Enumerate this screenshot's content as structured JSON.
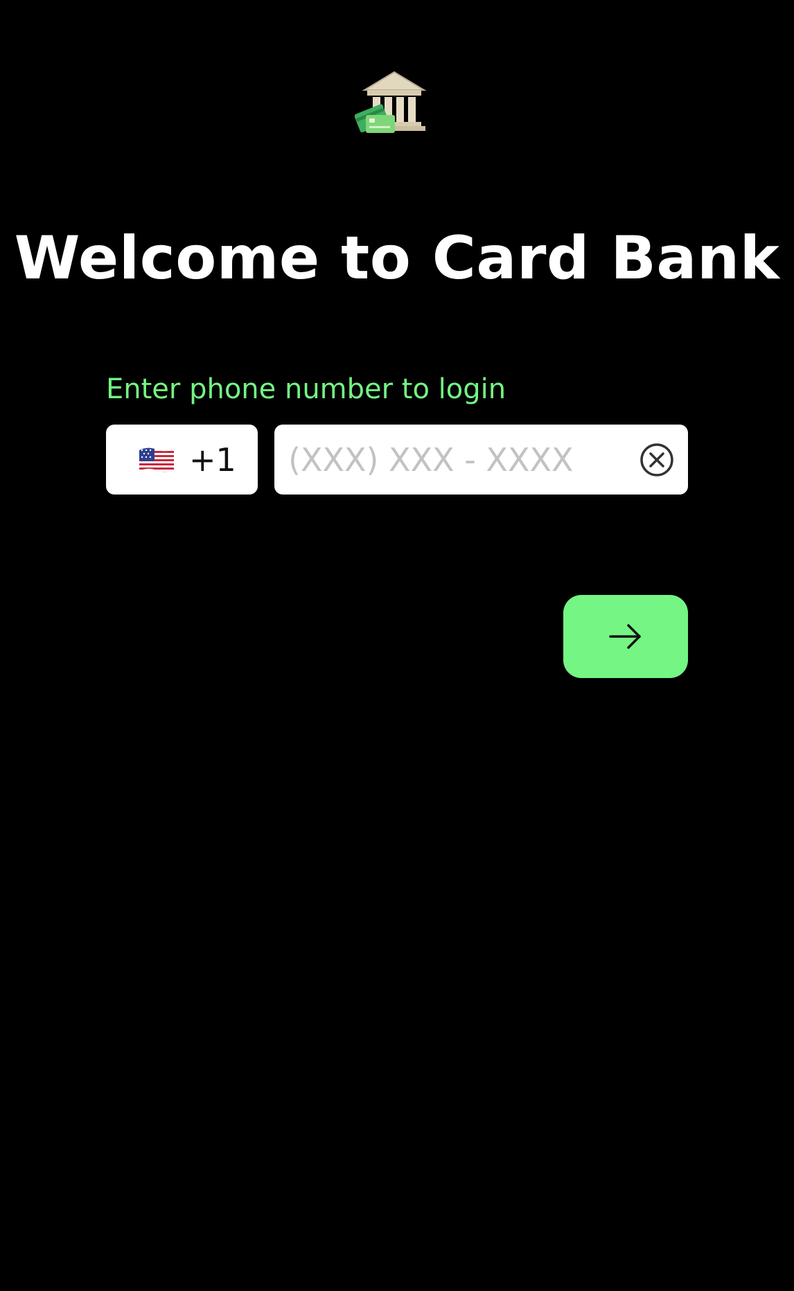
{
  "header": {
    "logo_icon": "bank-with-cards-icon"
  },
  "title": "Welcome to Card Bank",
  "login": {
    "prompt": "Enter phone number to login",
    "country": {
      "flag_icon": "us-flag-icon",
      "code": "+1"
    },
    "phone": {
      "value": "",
      "placeholder": "(XXX) XXX - XXXX"
    },
    "clear_icon": "clear-circle-x-icon",
    "next_icon": "arrow-right-icon"
  },
  "colors": {
    "background": "#000000",
    "accent": "#74f584",
    "title": "#ffffff",
    "field": "#ffffff",
    "placeholder": "#c2c2c2"
  }
}
